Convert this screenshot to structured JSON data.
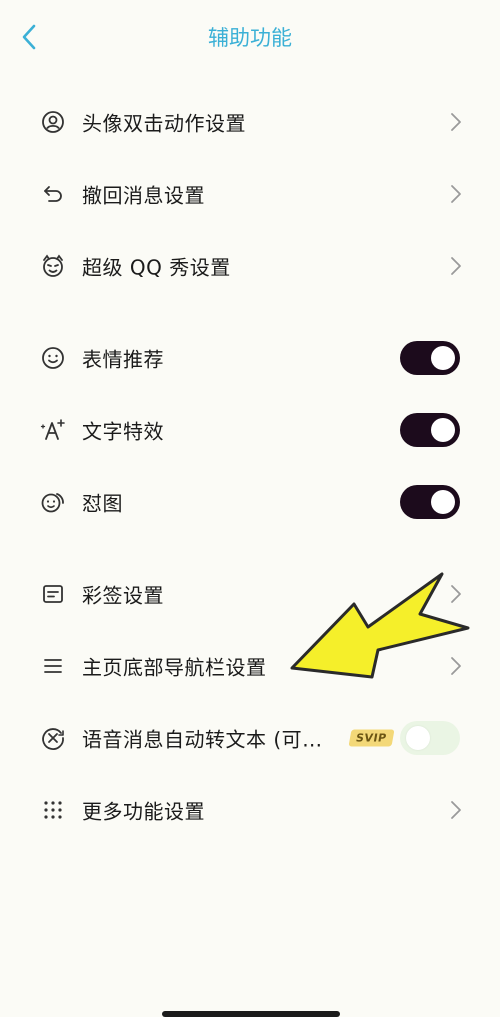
{
  "header": {
    "title": "辅助功能"
  },
  "group1": [
    {
      "label": "头像双击动作设置",
      "icon": "avatar-icon"
    },
    {
      "label": "撤回消息设置",
      "icon": "undo-icon"
    },
    {
      "label": "超级 QQ 秀设置",
      "icon": "qq-show-icon"
    }
  ],
  "group2": [
    {
      "label": "表情推荐",
      "icon": "smiley-icon",
      "toggle": "on"
    },
    {
      "label": "文字特效",
      "icon": "text-effect-icon",
      "toggle": "on"
    },
    {
      "label": "怼图",
      "icon": "sticker-reply-icon",
      "toggle": "on"
    }
  ],
  "group3": [
    {
      "label": "彩签设置",
      "icon": "tag-icon"
    },
    {
      "label": "主页底部导航栏设置",
      "icon": "menu-lines-icon"
    },
    {
      "label": "语音消息自动转文本 (可…",
      "icon": "voice-to-text-icon",
      "badge": "SVIP",
      "toggle": "off"
    },
    {
      "label": "更多功能设置",
      "icon": "grid-dots-icon"
    }
  ],
  "colors": {
    "accent": "#3bb0d6",
    "toggle_on": "#1c0b1c",
    "toggle_off": "#eaf5e4",
    "annotation_arrow": "#f5ef2a"
  }
}
